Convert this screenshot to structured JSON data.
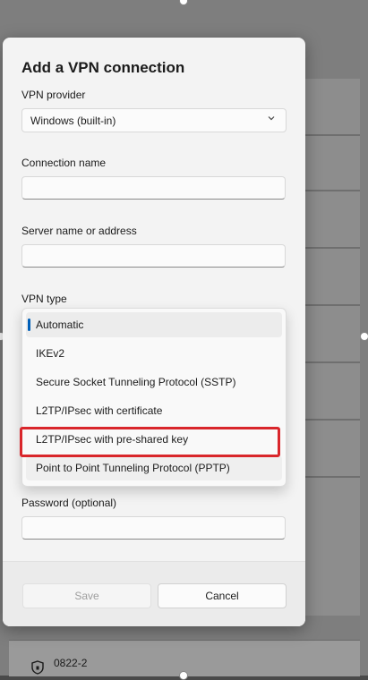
{
  "dialog": {
    "title": "Add a VPN connection",
    "vpn_provider": {
      "label": "VPN provider",
      "value": "Windows (built-in)"
    },
    "connection_name": {
      "label": "Connection name",
      "value": ""
    },
    "server": {
      "label": "Server name or address",
      "value": ""
    },
    "vpn_type": {
      "label": "VPN type",
      "options": [
        "Automatic",
        "IKEv2",
        "Secure Socket Tunneling Protocol (SSTP)",
        "L2TP/IPsec with certificate",
        "L2TP/IPsec with pre-shared key",
        "Point to Point Tunneling Protocol (PPTP)"
      ],
      "selected": "Automatic",
      "highlighted": "L2TP/IPsec with pre-shared key"
    },
    "password": {
      "label": "Password (optional)",
      "value": ""
    },
    "buttons": {
      "save": "Save",
      "cancel": "Cancel"
    }
  },
  "background": {
    "bottom_item_label": "0822-2"
  },
  "colors": {
    "accent": "#005fb8",
    "highlight_box": "#d9262b"
  }
}
